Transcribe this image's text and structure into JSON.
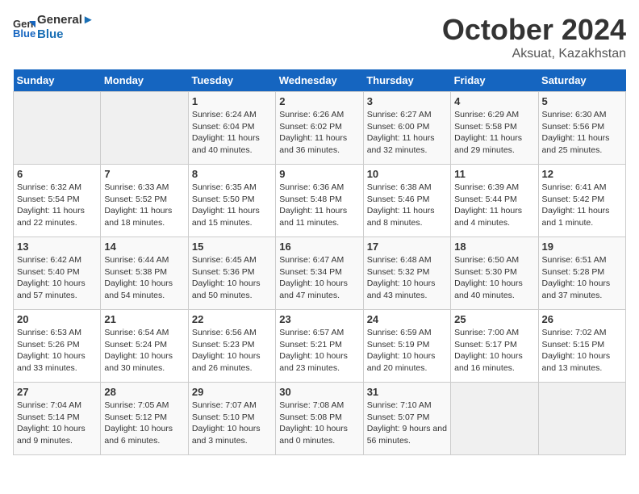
{
  "header": {
    "logo_line1": "General",
    "logo_line2": "Blue",
    "month": "October 2024",
    "location": "Aksuat, Kazakhstan"
  },
  "weekdays": [
    "Sunday",
    "Monday",
    "Tuesday",
    "Wednesday",
    "Thursday",
    "Friday",
    "Saturday"
  ],
  "weeks": [
    [
      {
        "day": "",
        "info": ""
      },
      {
        "day": "",
        "info": ""
      },
      {
        "day": "1",
        "info": "Sunrise: 6:24 AM\nSunset: 6:04 PM\nDaylight: 11 hours and 40 minutes."
      },
      {
        "day": "2",
        "info": "Sunrise: 6:26 AM\nSunset: 6:02 PM\nDaylight: 11 hours and 36 minutes."
      },
      {
        "day": "3",
        "info": "Sunrise: 6:27 AM\nSunset: 6:00 PM\nDaylight: 11 hours and 32 minutes."
      },
      {
        "day": "4",
        "info": "Sunrise: 6:29 AM\nSunset: 5:58 PM\nDaylight: 11 hours and 29 minutes."
      },
      {
        "day": "5",
        "info": "Sunrise: 6:30 AM\nSunset: 5:56 PM\nDaylight: 11 hours and 25 minutes."
      }
    ],
    [
      {
        "day": "6",
        "info": "Sunrise: 6:32 AM\nSunset: 5:54 PM\nDaylight: 11 hours and 22 minutes."
      },
      {
        "day": "7",
        "info": "Sunrise: 6:33 AM\nSunset: 5:52 PM\nDaylight: 11 hours and 18 minutes."
      },
      {
        "day": "8",
        "info": "Sunrise: 6:35 AM\nSunset: 5:50 PM\nDaylight: 11 hours and 15 minutes."
      },
      {
        "day": "9",
        "info": "Sunrise: 6:36 AM\nSunset: 5:48 PM\nDaylight: 11 hours and 11 minutes."
      },
      {
        "day": "10",
        "info": "Sunrise: 6:38 AM\nSunset: 5:46 PM\nDaylight: 11 hours and 8 minutes."
      },
      {
        "day": "11",
        "info": "Sunrise: 6:39 AM\nSunset: 5:44 PM\nDaylight: 11 hours and 4 minutes."
      },
      {
        "day": "12",
        "info": "Sunrise: 6:41 AM\nSunset: 5:42 PM\nDaylight: 11 hours and 1 minute."
      }
    ],
    [
      {
        "day": "13",
        "info": "Sunrise: 6:42 AM\nSunset: 5:40 PM\nDaylight: 10 hours and 57 minutes."
      },
      {
        "day": "14",
        "info": "Sunrise: 6:44 AM\nSunset: 5:38 PM\nDaylight: 10 hours and 54 minutes."
      },
      {
        "day": "15",
        "info": "Sunrise: 6:45 AM\nSunset: 5:36 PM\nDaylight: 10 hours and 50 minutes."
      },
      {
        "day": "16",
        "info": "Sunrise: 6:47 AM\nSunset: 5:34 PM\nDaylight: 10 hours and 47 minutes."
      },
      {
        "day": "17",
        "info": "Sunrise: 6:48 AM\nSunset: 5:32 PM\nDaylight: 10 hours and 43 minutes."
      },
      {
        "day": "18",
        "info": "Sunrise: 6:50 AM\nSunset: 5:30 PM\nDaylight: 10 hours and 40 minutes."
      },
      {
        "day": "19",
        "info": "Sunrise: 6:51 AM\nSunset: 5:28 PM\nDaylight: 10 hours and 37 minutes."
      }
    ],
    [
      {
        "day": "20",
        "info": "Sunrise: 6:53 AM\nSunset: 5:26 PM\nDaylight: 10 hours and 33 minutes."
      },
      {
        "day": "21",
        "info": "Sunrise: 6:54 AM\nSunset: 5:24 PM\nDaylight: 10 hours and 30 minutes."
      },
      {
        "day": "22",
        "info": "Sunrise: 6:56 AM\nSunset: 5:23 PM\nDaylight: 10 hours and 26 minutes."
      },
      {
        "day": "23",
        "info": "Sunrise: 6:57 AM\nSunset: 5:21 PM\nDaylight: 10 hours and 23 minutes."
      },
      {
        "day": "24",
        "info": "Sunrise: 6:59 AM\nSunset: 5:19 PM\nDaylight: 10 hours and 20 minutes."
      },
      {
        "day": "25",
        "info": "Sunrise: 7:00 AM\nSunset: 5:17 PM\nDaylight: 10 hours and 16 minutes."
      },
      {
        "day": "26",
        "info": "Sunrise: 7:02 AM\nSunset: 5:15 PM\nDaylight: 10 hours and 13 minutes."
      }
    ],
    [
      {
        "day": "27",
        "info": "Sunrise: 7:04 AM\nSunset: 5:14 PM\nDaylight: 10 hours and 9 minutes."
      },
      {
        "day": "28",
        "info": "Sunrise: 7:05 AM\nSunset: 5:12 PM\nDaylight: 10 hours and 6 minutes."
      },
      {
        "day": "29",
        "info": "Sunrise: 7:07 AM\nSunset: 5:10 PM\nDaylight: 10 hours and 3 minutes."
      },
      {
        "day": "30",
        "info": "Sunrise: 7:08 AM\nSunset: 5:08 PM\nDaylight: 10 hours and 0 minutes."
      },
      {
        "day": "31",
        "info": "Sunrise: 7:10 AM\nSunset: 5:07 PM\nDaylight: 9 hours and 56 minutes."
      },
      {
        "day": "",
        "info": ""
      },
      {
        "day": "",
        "info": ""
      }
    ]
  ]
}
